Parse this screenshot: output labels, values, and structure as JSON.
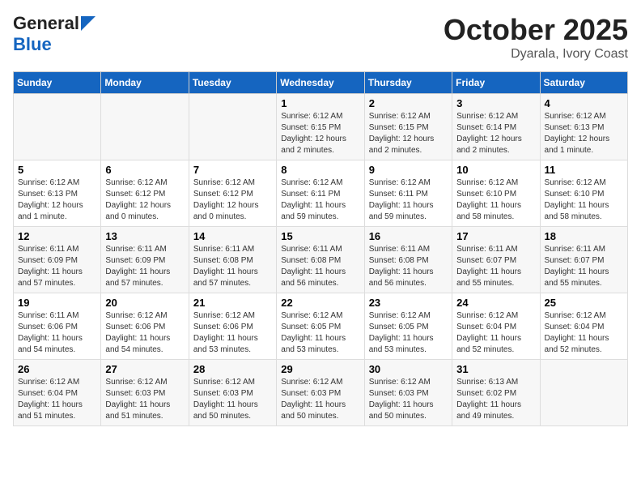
{
  "header": {
    "logo_line1": "General",
    "logo_line2": "Blue",
    "title": "October 2025",
    "subtitle": "Dyarala, Ivory Coast"
  },
  "calendar": {
    "weekdays": [
      "Sunday",
      "Monday",
      "Tuesday",
      "Wednesday",
      "Thursday",
      "Friday",
      "Saturday"
    ],
    "weeks": [
      [
        {
          "day": "",
          "sunrise": "",
          "sunset": "",
          "daylight": ""
        },
        {
          "day": "",
          "sunrise": "",
          "sunset": "",
          "daylight": ""
        },
        {
          "day": "",
          "sunrise": "",
          "sunset": "",
          "daylight": ""
        },
        {
          "day": "1",
          "sunrise": "Sunrise: 6:12 AM",
          "sunset": "Sunset: 6:15 PM",
          "daylight": "Daylight: 12 hours and 2 minutes."
        },
        {
          "day": "2",
          "sunrise": "Sunrise: 6:12 AM",
          "sunset": "Sunset: 6:15 PM",
          "daylight": "Daylight: 12 hours and 2 minutes."
        },
        {
          "day": "3",
          "sunrise": "Sunrise: 6:12 AM",
          "sunset": "Sunset: 6:14 PM",
          "daylight": "Daylight: 12 hours and 2 minutes."
        },
        {
          "day": "4",
          "sunrise": "Sunrise: 6:12 AM",
          "sunset": "Sunset: 6:13 PM",
          "daylight": "Daylight: 12 hours and 1 minute."
        }
      ],
      [
        {
          "day": "5",
          "sunrise": "Sunrise: 6:12 AM",
          "sunset": "Sunset: 6:13 PM",
          "daylight": "Daylight: 12 hours and 1 minute."
        },
        {
          "day": "6",
          "sunrise": "Sunrise: 6:12 AM",
          "sunset": "Sunset: 6:12 PM",
          "daylight": "Daylight: 12 hours and 0 minutes."
        },
        {
          "day": "7",
          "sunrise": "Sunrise: 6:12 AM",
          "sunset": "Sunset: 6:12 PM",
          "daylight": "Daylight: 12 hours and 0 minutes."
        },
        {
          "day": "8",
          "sunrise": "Sunrise: 6:12 AM",
          "sunset": "Sunset: 6:11 PM",
          "daylight": "Daylight: 11 hours and 59 minutes."
        },
        {
          "day": "9",
          "sunrise": "Sunrise: 6:12 AM",
          "sunset": "Sunset: 6:11 PM",
          "daylight": "Daylight: 11 hours and 59 minutes."
        },
        {
          "day": "10",
          "sunrise": "Sunrise: 6:12 AM",
          "sunset": "Sunset: 6:10 PM",
          "daylight": "Daylight: 11 hours and 58 minutes."
        },
        {
          "day": "11",
          "sunrise": "Sunrise: 6:12 AM",
          "sunset": "Sunset: 6:10 PM",
          "daylight": "Daylight: 11 hours and 58 minutes."
        }
      ],
      [
        {
          "day": "12",
          "sunrise": "Sunrise: 6:11 AM",
          "sunset": "Sunset: 6:09 PM",
          "daylight": "Daylight: 11 hours and 57 minutes."
        },
        {
          "day": "13",
          "sunrise": "Sunrise: 6:11 AM",
          "sunset": "Sunset: 6:09 PM",
          "daylight": "Daylight: 11 hours and 57 minutes."
        },
        {
          "day": "14",
          "sunrise": "Sunrise: 6:11 AM",
          "sunset": "Sunset: 6:08 PM",
          "daylight": "Daylight: 11 hours and 57 minutes."
        },
        {
          "day": "15",
          "sunrise": "Sunrise: 6:11 AM",
          "sunset": "Sunset: 6:08 PM",
          "daylight": "Daylight: 11 hours and 56 minutes."
        },
        {
          "day": "16",
          "sunrise": "Sunrise: 6:11 AM",
          "sunset": "Sunset: 6:08 PM",
          "daylight": "Daylight: 11 hours and 56 minutes."
        },
        {
          "day": "17",
          "sunrise": "Sunrise: 6:11 AM",
          "sunset": "Sunset: 6:07 PM",
          "daylight": "Daylight: 11 hours and 55 minutes."
        },
        {
          "day": "18",
          "sunrise": "Sunrise: 6:11 AM",
          "sunset": "Sunset: 6:07 PM",
          "daylight": "Daylight: 11 hours and 55 minutes."
        }
      ],
      [
        {
          "day": "19",
          "sunrise": "Sunrise: 6:11 AM",
          "sunset": "Sunset: 6:06 PM",
          "daylight": "Daylight: 11 hours and 54 minutes."
        },
        {
          "day": "20",
          "sunrise": "Sunrise: 6:12 AM",
          "sunset": "Sunset: 6:06 PM",
          "daylight": "Daylight: 11 hours and 54 minutes."
        },
        {
          "day": "21",
          "sunrise": "Sunrise: 6:12 AM",
          "sunset": "Sunset: 6:06 PM",
          "daylight": "Daylight: 11 hours and 53 minutes."
        },
        {
          "day": "22",
          "sunrise": "Sunrise: 6:12 AM",
          "sunset": "Sunset: 6:05 PM",
          "daylight": "Daylight: 11 hours and 53 minutes."
        },
        {
          "day": "23",
          "sunrise": "Sunrise: 6:12 AM",
          "sunset": "Sunset: 6:05 PM",
          "daylight": "Daylight: 11 hours and 53 minutes."
        },
        {
          "day": "24",
          "sunrise": "Sunrise: 6:12 AM",
          "sunset": "Sunset: 6:04 PM",
          "daylight": "Daylight: 11 hours and 52 minutes."
        },
        {
          "day": "25",
          "sunrise": "Sunrise: 6:12 AM",
          "sunset": "Sunset: 6:04 PM",
          "daylight": "Daylight: 11 hours and 52 minutes."
        }
      ],
      [
        {
          "day": "26",
          "sunrise": "Sunrise: 6:12 AM",
          "sunset": "Sunset: 6:04 PM",
          "daylight": "Daylight: 11 hours and 51 minutes."
        },
        {
          "day": "27",
          "sunrise": "Sunrise: 6:12 AM",
          "sunset": "Sunset: 6:03 PM",
          "daylight": "Daylight: 11 hours and 51 minutes."
        },
        {
          "day": "28",
          "sunrise": "Sunrise: 6:12 AM",
          "sunset": "Sunset: 6:03 PM",
          "daylight": "Daylight: 11 hours and 50 minutes."
        },
        {
          "day": "29",
          "sunrise": "Sunrise: 6:12 AM",
          "sunset": "Sunset: 6:03 PM",
          "daylight": "Daylight: 11 hours and 50 minutes."
        },
        {
          "day": "30",
          "sunrise": "Sunrise: 6:12 AM",
          "sunset": "Sunset: 6:03 PM",
          "daylight": "Daylight: 11 hours and 50 minutes."
        },
        {
          "day": "31",
          "sunrise": "Sunrise: 6:13 AM",
          "sunset": "Sunset: 6:02 PM",
          "daylight": "Daylight: 11 hours and 49 minutes."
        },
        {
          "day": "",
          "sunrise": "",
          "sunset": "",
          "daylight": ""
        }
      ]
    ]
  }
}
